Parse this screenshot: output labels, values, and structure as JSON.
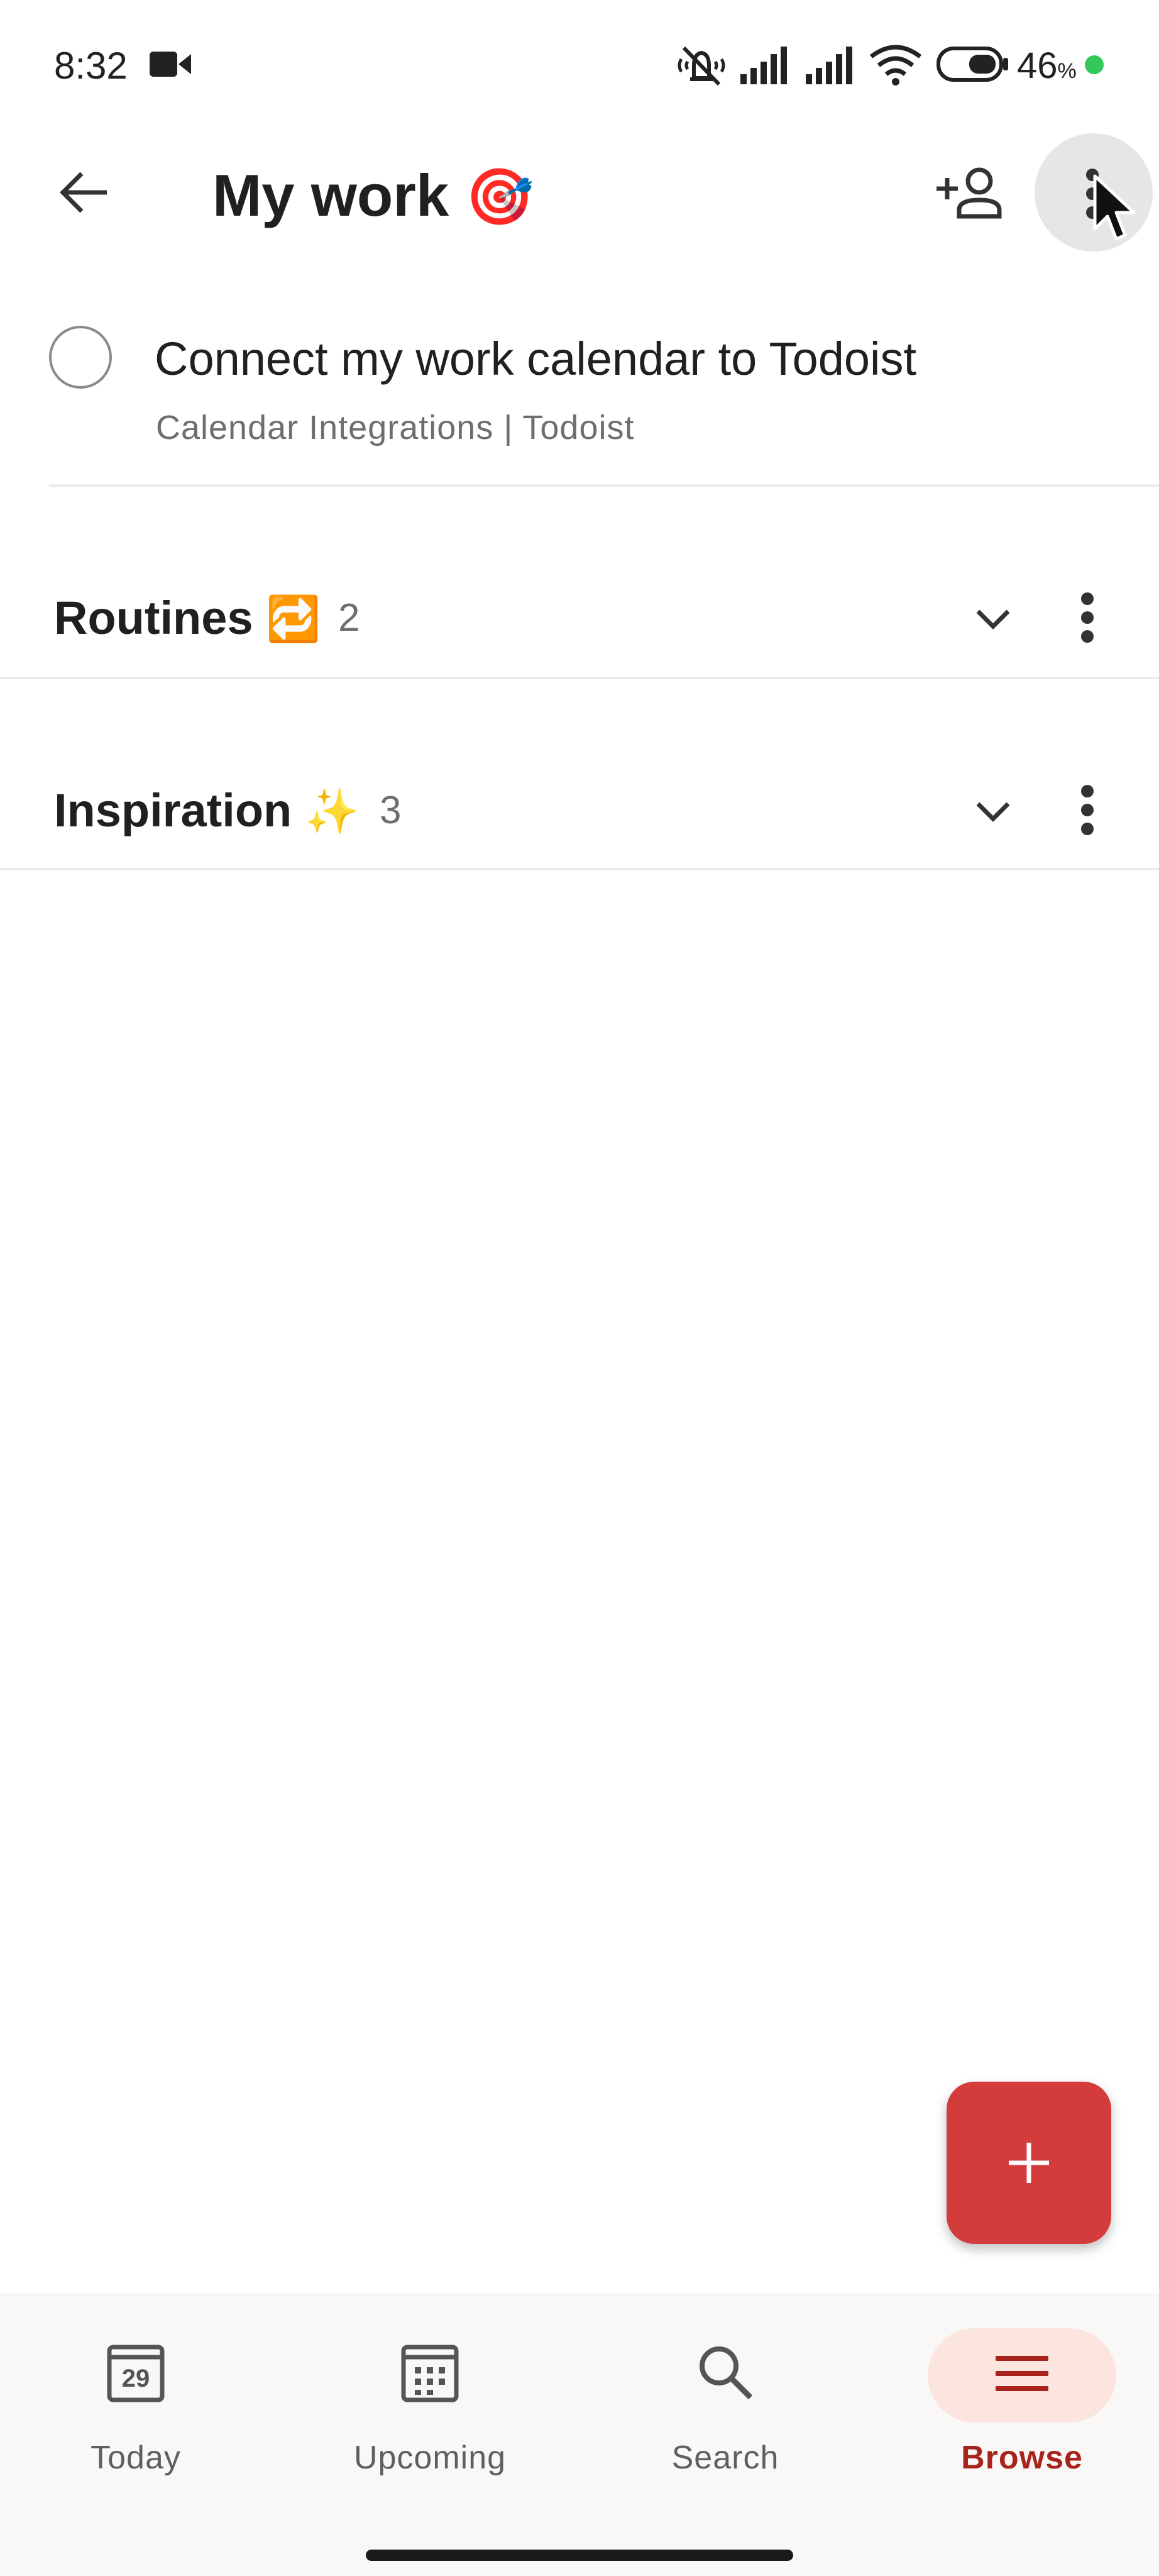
{
  "status_bar": {
    "time": "8:32",
    "battery_percent": "46",
    "battery_suffix": "%",
    "icons": [
      "video-camera-icon",
      "mute-vibrate-icon",
      "signal-icon",
      "signal-icon",
      "wifi-icon",
      "battery-icon",
      "charging-dot-icon"
    ],
    "charging_dot_color": "#34c759"
  },
  "header": {
    "title": "My work",
    "title_emoji": "🎯",
    "icons": [
      "back-arrow-icon",
      "add-person-icon",
      "more-vertical-icon"
    ]
  },
  "task": {
    "title": "Connect my work calendar to Todoist",
    "subtitle": "Calendar Integrations | Todoist",
    "completed": false
  },
  "sections": [
    {
      "name": "Routines",
      "emoji": "🔁",
      "count": "2",
      "collapsed": true
    },
    {
      "name": "Inspiration",
      "emoji": "✨",
      "count": "3",
      "collapsed": true
    }
  ],
  "fab": {
    "icon": "plus-icon",
    "color": "#d43b3b"
  },
  "bottom_nav": {
    "items": [
      {
        "label": "Today",
        "icon": "calendar-day-icon",
        "day": "29",
        "active": false
      },
      {
        "label": "Upcoming",
        "icon": "calendar-grid-icon",
        "active": false
      },
      {
        "label": "Search",
        "icon": "search-icon",
        "active": false
      },
      {
        "label": "Browse",
        "icon": "menu-lines-icon",
        "active": true
      }
    ],
    "active_color": "#a8231c",
    "active_pill_color": "#fde5df"
  }
}
